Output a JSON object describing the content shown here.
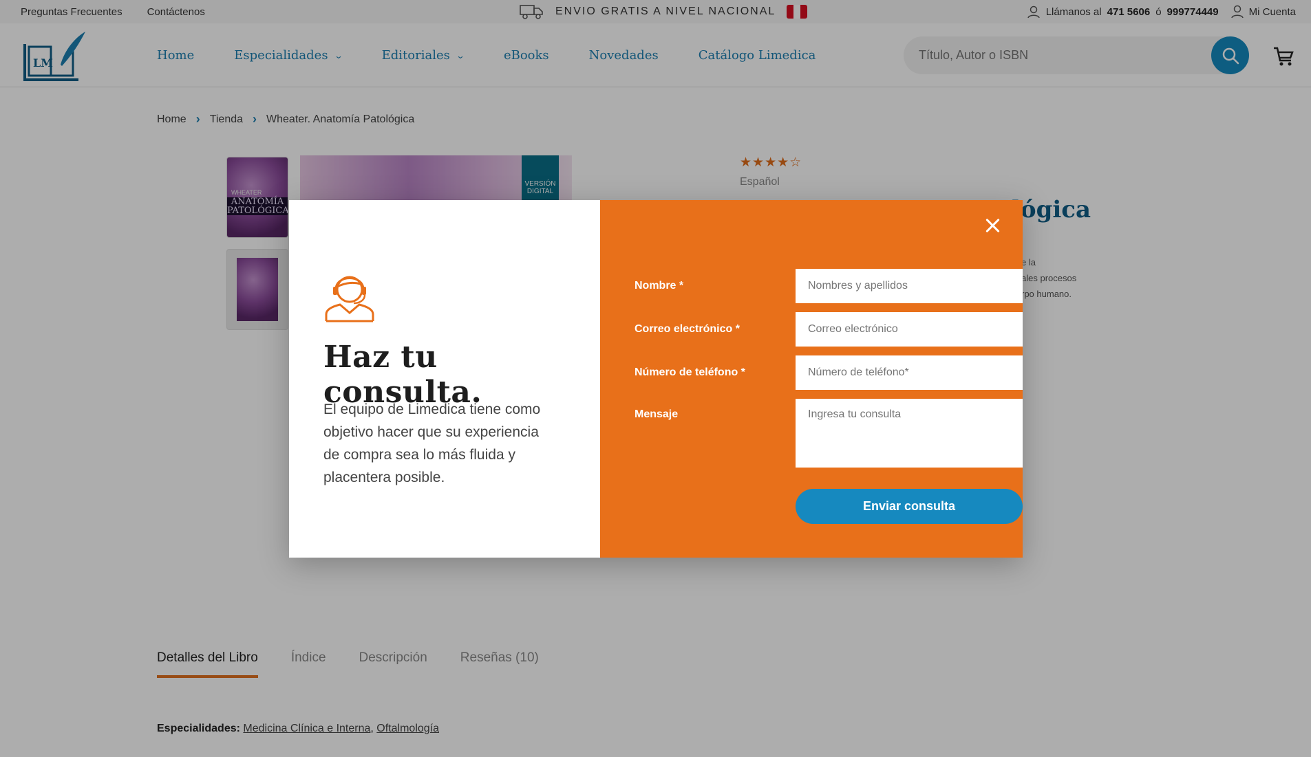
{
  "topbar": {
    "faq": "Preguntas Frecuentes",
    "contact": "Contáctenos",
    "shipping": "ENVIO GRATIS A NIVEL NACIONAL",
    "call_prefix": "Llámanos al",
    "phone1": "471 5606",
    "or": "ó",
    "phone2": "999774449",
    "account": "Mi Cuenta"
  },
  "header": {
    "logo_text": "LM",
    "nav": [
      "Home",
      "Especialidades",
      "Editoriales",
      "eBooks",
      "Novedades",
      "Catálogo Limedica"
    ],
    "search_placeholder": "Título, Autor o ISBN"
  },
  "breadcrumb": [
    "Home",
    "Tienda",
    "Wheater. Anatomía Patológica"
  ],
  "product": {
    "cover_band": "ANATOMÍA PATOLÓGICA",
    "cover_author": "WHEATER",
    "digital_badge": "VERSIÓN DIGITAL",
    "language": "Español",
    "title_peek": "lógica",
    "desc_peek": [
      "e la",
      "ales procesos",
      "rpo humano."
    ],
    "stars": "★★★★☆"
  },
  "tabs": [
    "Detalles del Libro",
    "Índice",
    "Descripción",
    "Reseñas (10)"
  ],
  "specs": {
    "label": "Especialidades:",
    "links": [
      "Medicina Clínica e Interna",
      "Oftalmología"
    ],
    "separator": ","
  },
  "modal": {
    "heading": "Haz tu consulta.",
    "intro": "El equipo de Limedica tiene como objetivo hacer que su experiencia de compra sea lo más fluida y placentera posible.",
    "fields": {
      "name_label": "Nombre *",
      "name_placeholder": "Nombres y apellidos",
      "email_label": "Correo electrónico *",
      "email_placeholder": "Correo electrónico",
      "phone_label": "Número de teléfono *",
      "phone_placeholder": "Número de teléfono*",
      "message_label": "Mensaje",
      "message_placeholder": "Ingresa tu consulta"
    },
    "submit": "Enviar consulta"
  },
  "colors": {
    "brand_blue": "#1689bf",
    "accent_orange": "#e8701a",
    "title_blue": "#0f5e86"
  },
  "icons": [
    "truck-icon",
    "peru-flag-icon",
    "user-icon",
    "account-icon",
    "chevron-down-icon",
    "search-icon",
    "cart-icon",
    "chevron-right-icon",
    "support-agent-icon",
    "close-icon"
  ]
}
